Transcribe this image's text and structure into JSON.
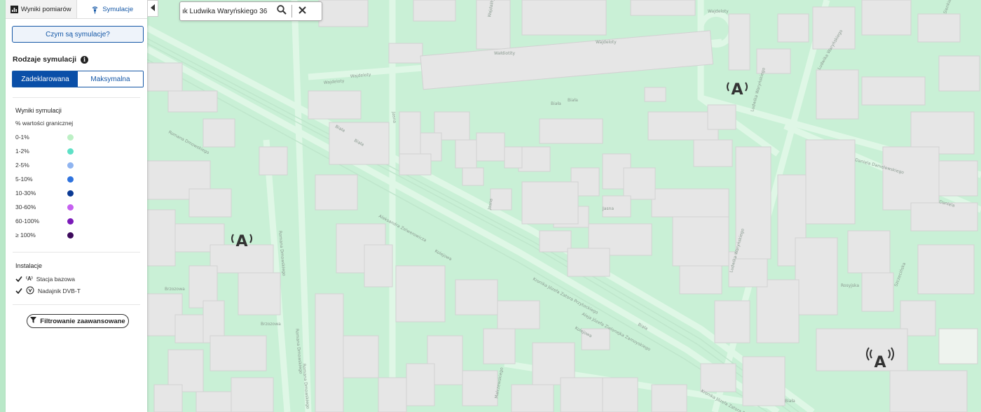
{
  "tabs": [
    {
      "label": "Wyniki pomiarów",
      "icon": "bar-chart-icon",
      "active": false
    },
    {
      "label": "Symulacje",
      "icon": "signal-simulation-icon",
      "active": true
    }
  ],
  "what_button": "Czym są symulacje?",
  "sim_types": {
    "title": "Rodzaje symulacji",
    "options": [
      "Zadeklarowana",
      "Maksymalna"
    ],
    "selected": "Zadeklarowana"
  },
  "results": {
    "title": "Wyniki symulacji",
    "subtitle": "% wartości granicznej",
    "legend": [
      {
        "label": "0-1%",
        "color": "#bdf0c5"
      },
      {
        "label": "1-2%",
        "color": "#5ee0c6"
      },
      {
        "label": "2-5%",
        "color": "#8fb4f0"
      },
      {
        "label": "5-10%",
        "color": "#2f73de"
      },
      {
        "label": "10-30%",
        "color": "#0b3a94"
      },
      {
        "label": "30-60%",
        "color": "#c661f0"
      },
      {
        "label": "60-100%",
        "color": "#7a1ab8"
      },
      {
        "label": "≥ 100%",
        "color": "#3d0a5c"
      }
    ]
  },
  "installations": {
    "title": "Instalacje",
    "items": [
      {
        "label": "Stacja bazowa",
        "checked": true,
        "icon": "base-station-icon"
      },
      {
        "label": "Nadajnik DVB-T",
        "checked": true,
        "icon": "dvbt-transmitter-icon"
      }
    ]
  },
  "filter_button": "Filtrowanie zaawansowane",
  "search": {
    "value": "ık Ludwika Waryńskiego 36"
  },
  "map": {
    "coverage_color": "#c9f0d6",
    "street_labels": [
      "Wałdiotity",
      "Wajdeloty",
      "Wajdeloty",
      "Wajdeloty",
      "Wajdeloty",
      "Biała",
      "Biała",
      "Biała",
      "Biała",
      "Biała",
      "Romana Dmowskiego",
      "Romana Dmowskiego",
      "Romana Dmowskiego",
      "Romana Dmowskiego",
      "Brzozowa",
      "Brzozowa",
      "Aleksandra Zelwerowicza",
      "Kolejowa",
      "Kolejowa",
      "Ludwika Waryńskiego",
      "Ludwika Waryńskiego",
      "Ludwika Waryńskiego",
      "Daniela Danielewskiego",
      "Daniela",
      "Szczecińska",
      "Sienkiewicza",
      "Malczewskiego",
      "Aleja Józefa Zielonejka Zamoyskiego",
      "Jasna",
      "Jasna",
      "Jasna",
      "Wajdality",
      "Kronika Józefa Zatora Przytockiego",
      "Kronika Józefa Zatora Przytockiego",
      "Rosyjska",
      "Biała"
    ],
    "antennas": [
      {
        "icon": "base-station-icon"
      },
      {
        "icon": "base-station-icon"
      },
      {
        "icon": "dvbt-transmitter-icon"
      }
    ]
  }
}
